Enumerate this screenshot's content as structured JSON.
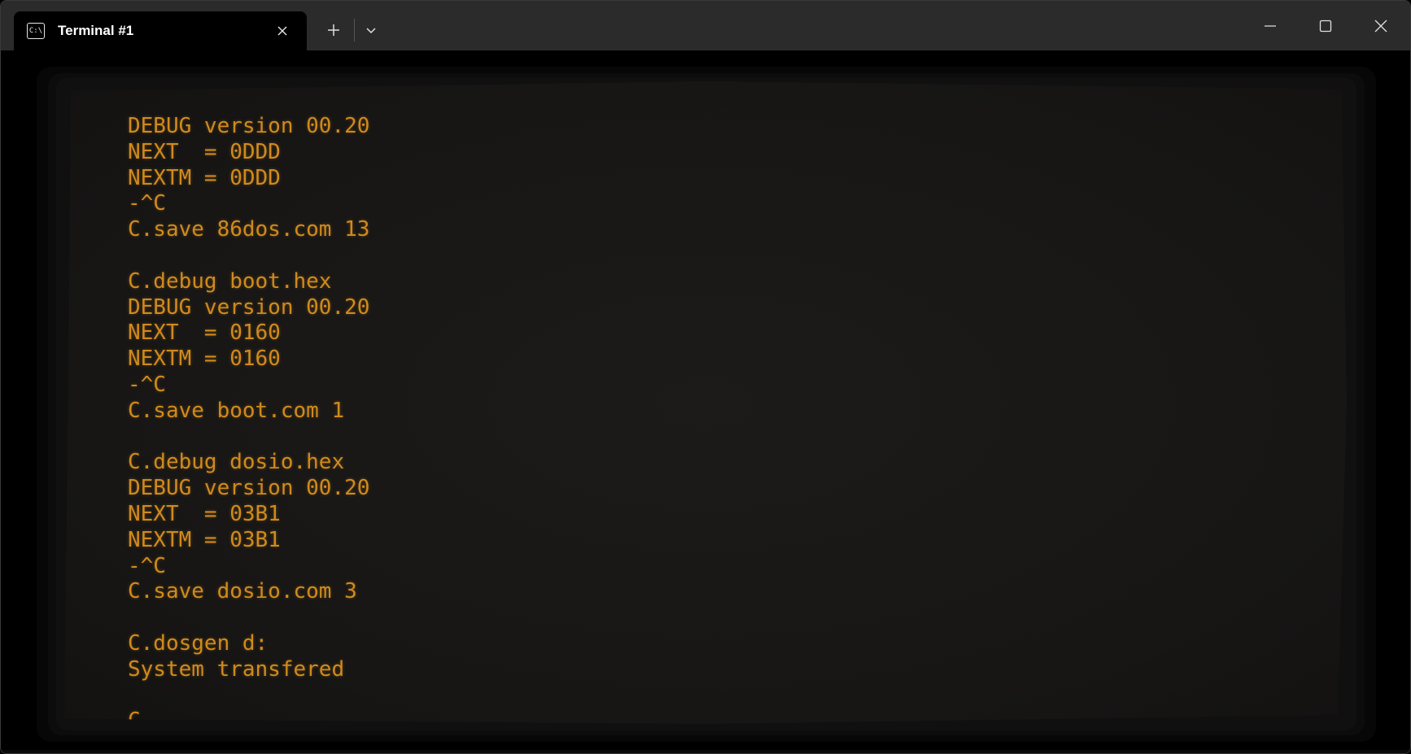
{
  "window": {
    "tab_title": "Terminal #1",
    "tab_icon": "C:\\",
    "icons": {
      "tab": "command-prompt-icon",
      "tab_close": "close-icon",
      "new_tab": "plus-icon",
      "dropdown": "chevron-down-icon",
      "minimize": "minimize-icon",
      "maximize": "maximize-icon",
      "close": "close-icon"
    }
  },
  "terminal": {
    "text_color": "#d08a1c",
    "background": "#171615",
    "lines": [
      "DEBUG version 00.20",
      "NEXT  = 0DDD",
      "NEXTM = 0DDD",
      "-^C",
      "C.save 86dos.com 13",
      "",
      "C.debug boot.hex",
      "DEBUG version 00.20",
      "NEXT  = 0160",
      "NEXTM = 0160",
      "-^C",
      "C.save boot.com 1",
      "",
      "C.debug dosio.hex",
      "DEBUG version 00.20",
      "NEXT  = 03B1",
      "NEXTM = 03B1",
      "-^C",
      "C.save dosio.com 3",
      "",
      "C.dosgen d:",
      "System transfered",
      "",
      "C."
    ]
  }
}
